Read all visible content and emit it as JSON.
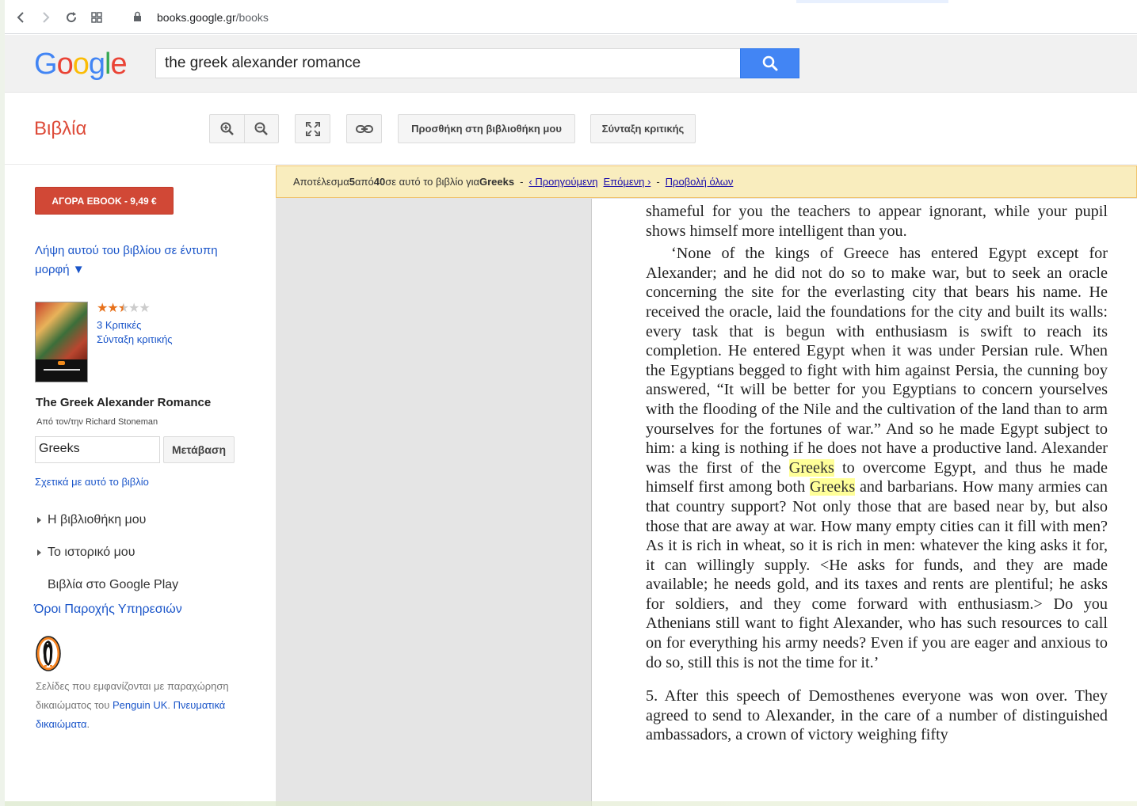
{
  "browser": {
    "url_host": "books.google.gr",
    "url_path": "/books"
  },
  "search": {
    "query": "the greek alexander romance"
  },
  "header": {
    "section_title": "Βιβλία",
    "add_library_label": "Προσθήκη στη βιβλιοθήκη μου",
    "write_review_label": "Σύνταξη κριτικής"
  },
  "sidebar": {
    "buy_label": "ΑΓΟΡΑ EBOOK - 9,49 €",
    "print_link": "Λήψη αυτού του βιβλίου σε έντυπη μορφή ▼",
    "rating": 2.5,
    "reviews_count_label": "3 Κριτικές",
    "write_review_link": "Σύνταξη κριτικής",
    "book_title": "The Greek Alexander Romance",
    "author_line": "Από τον/την Richard Stoneman",
    "in_book_query": "Greeks",
    "go_label": "Μετάβαση",
    "about_link": "Σχετικά με αυτό το βιβλίο",
    "nav": [
      "Η βιβλιοθήκη μου",
      "Το ιστορικό μου",
      "Βιβλία στο Google Play"
    ],
    "terms_link": "Όροι Παροχής Υπηρεσιών",
    "credit_text_1": "Σελίδες που εμφανίζονται με παραχώρηση δικαιώματος του ",
    "credit_publisher": "Penguin UK",
    "credit_rights": "Πνευματικά δικαιώματα",
    "colors": {
      "buy": "#d14836",
      "link": "#1a55c9",
      "title": "#dd4b39"
    }
  },
  "results_bar": {
    "prefix": "Αποτέλεσμα ",
    "current": "5",
    "of": " από ",
    "total": "40",
    "middle": " σε αυτό το βιβλίο για ",
    "term": "Greeks",
    "prev": "‹ Προηγούμενη",
    "next": "Επόμενη ›",
    "view_all": "Προβολή όλων"
  },
  "page_text": {
    "p1": "shameful for you the teachers to appear ignorant, while your pupil shows himself more intelligent than you.",
    "p2a": "‘None of the kings of Greece has entered Egypt except for Alexander; and he did not do so to make war, but to seek an oracle concerning the site for the everlasting city that bears his name. He received the oracle, laid the foundations for the city and built its walls: every task that is begun with enthusiasm is swift to reach its completion. He entered Egypt when it was under Persian rule. When the Egyptians begged to fight with him against Persia, the cunning boy answered, “It will be better for you Egyptians to concern yourselves with the flooding of the Nile and the cultivation of the land than to arm yourselves for the fortunes of war.” And so he made Egypt subject to him: a king is nothing if he does not have a productive land. Alexander was the first of the ",
    "hl1": "Greeks",
    "p2b": " to overcome Egypt, and thus he made himself first among both ",
    "hl2": "Greeks",
    "p2c": " and barbarians. How many armies can that country support? Not only those that are based near by, but also those that are away at war. How many empty cities can it fill with men? As it is rich in wheat, so it is rich in men: whatever the king asks it for, it can willingly supply. <He asks for funds, and they are made available; he needs gold, and its taxes and rents are plentiful; he asks for soldiers, and they come forward with enthusiasm.> Do you Athenians still want to fight Alexander, who has such resources to call on for everything his army needs? Even if you are eager and anxious to do so, still this is not the time for it.’",
    "p3": "5. After this speech of Demosthenes everyone was won over. They agreed to send to Alexander, in the care of a number of distinguished ambassadors, a crown of victory weighing fifty"
  }
}
